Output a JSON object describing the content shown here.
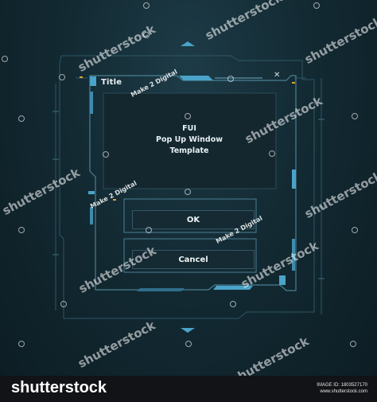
{
  "window": {
    "title": "Title",
    "close_glyph": "✕",
    "message_lines": [
      "FUI",
      "Pop Up Window",
      "Template"
    ]
  },
  "buttons": {
    "ok_label": "OK",
    "cancel_label": "Cancel"
  },
  "watermarks": {
    "large_text": "shutterstock",
    "small_text": "Make 2 Digital"
  },
  "footer": {
    "logo_text": "shutterstock",
    "image_id": "IMAGE ID: 1803527170",
    "site": "www.shutterstock.com"
  },
  "colors": {
    "background": "#132a33",
    "frame_line": "#3f6e80",
    "accent_blue": "#4aa3c8",
    "accent_orange": "#d9a637"
  },
  "icons": [
    "close-icon",
    "chevron-up-icon",
    "chevron-down-icon",
    "camera-lens-icon"
  ]
}
